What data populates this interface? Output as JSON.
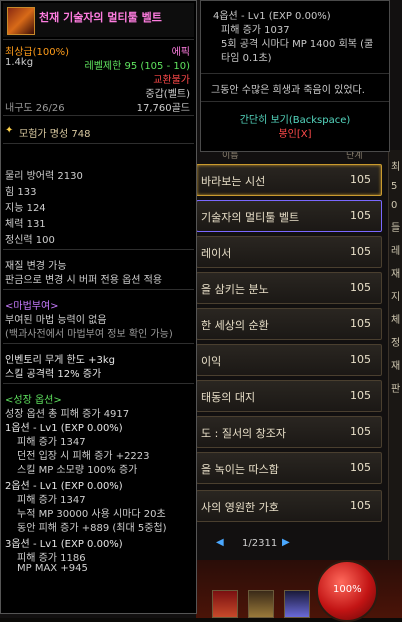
{
  "item": {
    "name": "천재 기술자의 멀티툴 벨트",
    "grade": "최상급(100%)",
    "rarity": "에픽",
    "weight": "1.4kg",
    "level_limit": "레벨제한 95 (105 - 10)",
    "trade": "교환불가",
    "type": "중갑(벨트)",
    "durability": "내구도 26/26",
    "price": "17,760골드",
    "adventurer_fame": "모험가 명성 748",
    "stats": [
      "물리 방어력 2130",
      "힘 133",
      "지능 124",
      "체력 131",
      "정신력 100"
    ],
    "material_change": "재질 변경 가능",
    "judgment_note": "판금으로 변경 시 버퍼 전용 옵션 적용",
    "magic_header": "<마법부여>",
    "magic_none": "부여된 마법 능력이 없음",
    "magic_hint": "(백과사전에서 마법부여 정보 확인 가능)",
    "inventory_weight": "인벤토리 무게 한도 +3kg",
    "skill_attack": "스킬 공격력 12% 증가",
    "growth_header": "<성장 옵션>",
    "growth_total": "성장 옵션 총 피해 증가 4917",
    "options": [
      {
        "header": "1옵션 - Lv1 (EXP 0.00%)",
        "lines": [
          "피해 증가 1347",
          "던전 입장 시 피해 증가 +2223",
          "스킬 MP 소모량 100% 증가"
        ]
      },
      {
        "header": "2옵션 - Lv1 (EXP 0.00%)",
        "lines": [
          "피해 증가 1347",
          "누적 MP 30000 사용 시마다 20초",
          "동안 피해 증가 +889 (최대 5중첩)"
        ]
      },
      {
        "header": "3옵션 - Lv1 (EXP 0.00%)",
        "lines": [
          "피해 증가 1186",
          "MP MAX +945"
        ]
      }
    ]
  },
  "tooltip2": {
    "option_header": "4옵션 - Lv1 (EXP 0.00%)",
    "damage": "피해 증가 1037",
    "hit5": "5회 공격 시마다 MP 1400 회복 (쿨",
    "hit5b": "타임 0.1초)",
    "flavor": "그동안 수많은 희생과 죽음이 있었다.",
    "simple_view": "간단히 보기(Backspace)",
    "seal": "봉인[X]"
  },
  "list": {
    "header_left": "이름",
    "header_right": "단계",
    "rows": [
      {
        "name": "바라보는 시선",
        "value": "105"
      },
      {
        "name": "기술자의 멀티툴 벨트",
        "value": "105"
      },
      {
        "name": "레이서",
        "value": "105"
      },
      {
        "name": "을 삼키는 분노",
        "value": "105"
      },
      {
        "name": "한 세상의 순환",
        "value": "105"
      },
      {
        "name": "이익",
        "value": "105"
      },
      {
        "name": "태동의 대지",
        "value": "105"
      },
      {
        "name": "도 : 질서의 창조자",
        "value": "105"
      },
      {
        "name": "을 녹이는 따스함",
        "value": "105"
      },
      {
        "name": "사의 영원한 가호",
        "value": "105"
      }
    ],
    "page": "1/2311"
  },
  "hud": {
    "hp": "100%"
  },
  "right_strip": [
    "최",
    "5",
    "0",
    "들",
    "레",
    "재",
    "지",
    "체",
    "정",
    "재",
    "판"
  ],
  "colors": {
    "epic": "#ff7de0",
    "orange": "#ff9c1a",
    "green": "#5fe35f",
    "red": "#ff4a4a",
    "teal": "#55d8c0"
  },
  "icons": {
    "title": "belt-item-icon",
    "fame": "adventurer-fame-icon",
    "prev": "arrow-left-icon",
    "next": "arrow-right-icon"
  }
}
